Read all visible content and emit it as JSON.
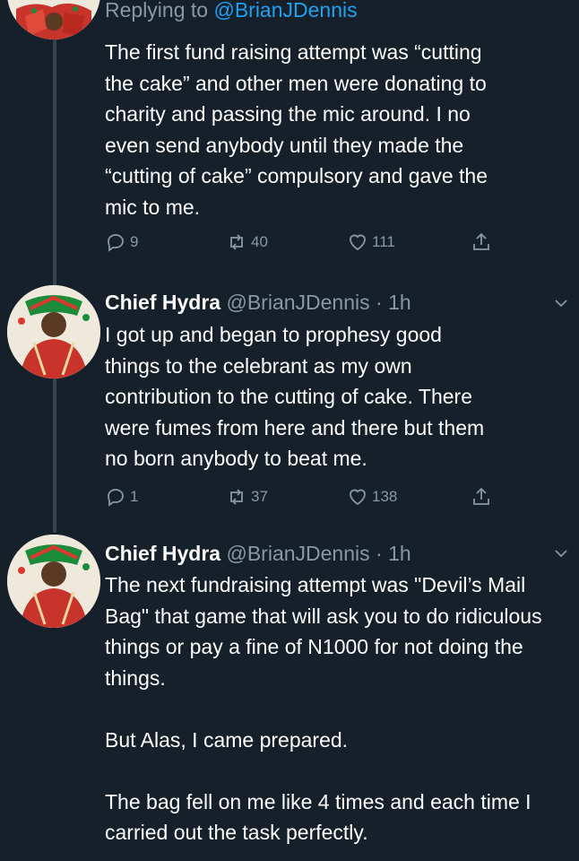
{
  "tweets": [
    {
      "replying_prefix": "Replying to",
      "replying_to": "@BrianJDennis",
      "lines": [
        "The first fund raising attempt was “cutting",
        "the cake” and other men were donating to",
        "charity and passing the mic around. I no",
        "even send anybody until they made the",
        "“cutting of cake” compulsory and gave the",
        "mic to me."
      ],
      "replies": "9",
      "retweets": "40",
      "likes": "111"
    },
    {
      "name": "Chief Hydra",
      "handle": "@BrianJDennis",
      "separator": "·",
      "time": "1h",
      "lines": [
        "I got up and began to prophesy good",
        "things to the celebrant as my own",
        "contribution to the cutting of cake. There",
        "were fumes from here and there but them",
        "no born anybody to beat me."
      ],
      "replies": "1",
      "retweets": "37",
      "likes": "138"
    },
    {
      "name": "Chief Hydra",
      "handle": "@BrianJDennis",
      "separator": "·",
      "time": "1h",
      "paragraphs": [
        "The next fundraising attempt was \"Devil’s Mail Bag\" that game that will ask you to do ridiculous things or pay a fine of N1000 for not doing the things.",
        "But Alas, I came prepared.",
        "The bag fell on me like 4 times and each time I carried out the task perfectly."
      ]
    }
  ],
  "icons": {
    "reply": "reply-icon",
    "retweet": "retweet-icon",
    "like": "heart-icon",
    "share": "share-icon",
    "more": "chevron-down-icon"
  },
  "colors": {
    "background": "#15202b",
    "text": "#ffffff",
    "muted": "#8899a6",
    "link": "#1da1f2",
    "thread_line": "#38444d"
  }
}
